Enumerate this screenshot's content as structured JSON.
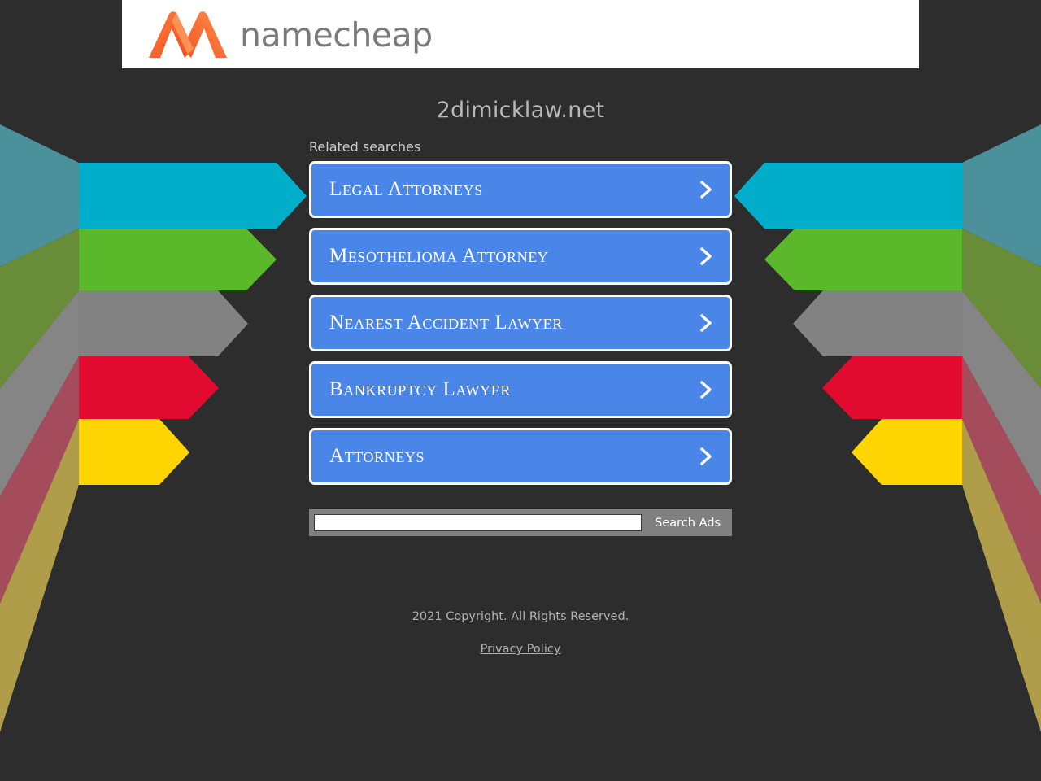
{
  "theme": {
    "page_bg": "#2d2d2d",
    "header_bg": "#ffffff",
    "button_blue": "#4a86e8",
    "button_border": "#ffffff",
    "search_bar_bg": "#808080",
    "title_color": "#b8b8b8",
    "logo_orange": "#f26322"
  },
  "header": {
    "logo_icon": "namecheap-logo-icon",
    "brand": "namecheap"
  },
  "main": {
    "domain_title": "2dimicklaw.net",
    "related_label": "Related searches",
    "links": [
      {
        "label": "Legal Attorneys",
        "icon": "chevron-right-icon"
      },
      {
        "label": "Mesothelioma Attorney",
        "icon": "chevron-right-icon"
      },
      {
        "label": "Nearest Accident Lawyer",
        "icon": "chevron-right-icon"
      },
      {
        "label": "Bankruptcy Lawyer",
        "icon": "chevron-right-icon"
      },
      {
        "label": "Attorneys",
        "icon": "chevron-right-icon"
      }
    ]
  },
  "search": {
    "value": "",
    "placeholder": "",
    "button_label": "Search Ads"
  },
  "footer": {
    "copyright": "2021 Copyright. All Rights Reserved.",
    "privacy_link": "Privacy Policy"
  },
  "background_art": {
    "description": "five horizontal arrow bands mirrored left and right with faded light beams",
    "bands": [
      {
        "name": "cyan",
        "color": "#00ade0",
        "solid": "#00aec9"
      },
      {
        "name": "green",
        "color": "#5cb82b",
        "solid": "#5cb82b"
      },
      {
        "name": "gray",
        "color": "#878787",
        "solid": "#8a8a8a"
      },
      {
        "name": "red",
        "color": "#e00b2e",
        "solid": "#e00b2e"
      },
      {
        "name": "yellow",
        "color": "#ffd500",
        "solid": "#ffd500"
      }
    ]
  }
}
